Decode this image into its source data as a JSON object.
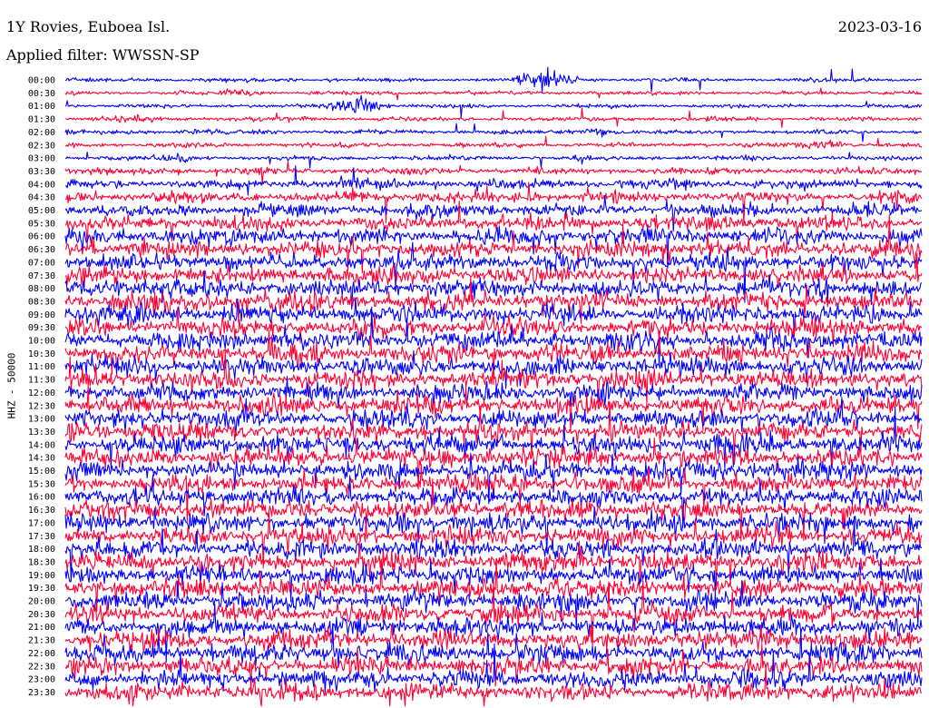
{
  "header": {
    "station": "1Y Rovies, Euboea Isl.",
    "date": "2023-03-16",
    "filter": "Applied filter: WWSSN-SP"
  },
  "chart_data": {
    "type": "line",
    "title": "1Y Rovies, Euboea Isl.",
    "ylabel": "HHZ - 50000",
    "xlabel": "",
    "row_labels": [
      "00:00",
      "00:30",
      "01:00",
      "01:30",
      "02:00",
      "02:30",
      "03:00",
      "03:30",
      "04:00",
      "04:30",
      "05:00",
      "05:30",
      "06:00",
      "06:30",
      "07:00",
      "07:30",
      "08:00",
      "08:30",
      "09:00",
      "09:30",
      "10:00",
      "10:30",
      "11:00",
      "11:30",
      "12:00",
      "12:30",
      "13:00",
      "13:30",
      "14:00",
      "14:30",
      "15:00",
      "15:30",
      "16:00",
      "16:30",
      "17:00",
      "17:30",
      "18:00",
      "18:30",
      "19:00",
      "19:30",
      "20:00",
      "20:30",
      "21:00",
      "21:30",
      "22:00",
      "22:30",
      "23:00",
      "23:30"
    ],
    "row_duration_minutes": 30,
    "series_colors": [
      "#0000ff",
      "#ff0033"
    ],
    "row_amplitude_level": [
      0.06,
      0.06,
      0.06,
      0.08,
      0.09,
      0.09,
      0.1,
      0.18,
      0.3,
      0.38,
      0.45,
      0.55,
      0.6,
      0.62,
      0.64,
      0.66,
      0.68,
      0.68,
      0.7,
      0.7,
      0.7,
      0.7,
      0.7,
      0.7,
      0.7,
      0.7,
      0.7,
      0.7,
      0.7,
      0.7,
      0.7,
      0.7,
      0.7,
      0.7,
      0.7,
      0.7,
      0.7,
      0.7,
      0.7,
      0.7,
      0.7,
      0.7,
      0.7,
      0.7,
      0.7,
      0.7,
      0.7,
      0.7
    ],
    "events": [
      {
        "row": 1,
        "position": 0.2,
        "level": 0.5
      },
      {
        "row": 3,
        "position": 0.08,
        "level": 0.7
      },
      {
        "row": 3,
        "position": 0.25,
        "level": 0.6
      },
      {
        "row": 4,
        "position": 0.62,
        "level": 1.0
      },
      {
        "row": 5,
        "position": 0.89,
        "level": 0.9
      },
      {
        "row": 6,
        "position": 0.14,
        "level": 0.6
      },
      {
        "row": 0,
        "position": 0.56,
        "level": 3.5
      },
      {
        "row": 2,
        "position": 0.34,
        "level": 2.5
      }
    ]
  }
}
